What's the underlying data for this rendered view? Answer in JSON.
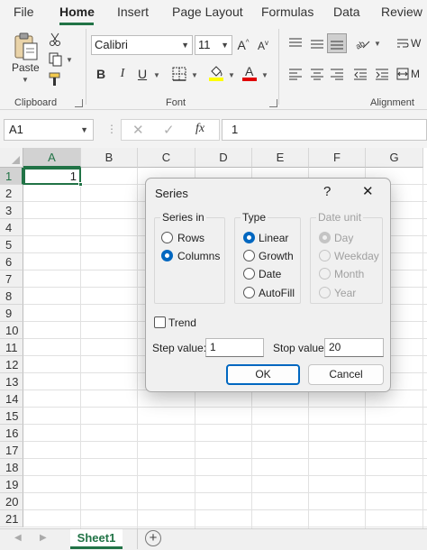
{
  "menu": {
    "tabs": [
      {
        "label": "File"
      },
      {
        "label": "Home"
      },
      {
        "label": "Insert"
      },
      {
        "label": "Page Layout"
      },
      {
        "label": "Formulas"
      },
      {
        "label": "Data"
      },
      {
        "label": "Review"
      }
    ],
    "active_tab": "Home",
    "accent_color": "#217346"
  },
  "ribbon": {
    "clipboard": {
      "paste_label": "Paste",
      "group_label": "Clipboard"
    },
    "font": {
      "font_name": "Calibri",
      "font_size": "11",
      "group_label": "Font",
      "bold": "B",
      "italic": "I",
      "underline": "U"
    },
    "alignment": {
      "group_label": "Alignment",
      "wrap_partial": "W",
      "merge_partial": "M"
    }
  },
  "formula_bar": {
    "name_box": "A1",
    "fx_label": "fx",
    "value": "1"
  },
  "grid": {
    "columns": [
      "A",
      "B",
      "C",
      "D",
      "E",
      "F",
      "G"
    ],
    "rows": [
      "1",
      "2",
      "3",
      "4",
      "5",
      "6",
      "7",
      "8",
      "9",
      "10",
      "11",
      "12",
      "13",
      "14",
      "15",
      "16",
      "17",
      "18",
      "19",
      "20",
      "21"
    ],
    "selected_cell": "A1",
    "cells": {
      "A1": "1"
    }
  },
  "sheet_tabs": {
    "active": "Sheet1",
    "add_symbol": "+"
  },
  "dialog": {
    "title": "Series",
    "help_symbol": "?",
    "close_symbol": "✕",
    "series_in": {
      "label": "Series in",
      "options": [
        "Rows",
        "Columns"
      ],
      "selected": "Columns"
    },
    "type": {
      "label": "Type",
      "options": [
        "Linear",
        "Growth",
        "Date",
        "AutoFill"
      ],
      "selected": "Linear"
    },
    "date_unit": {
      "label": "Date unit",
      "options": [
        "Day",
        "Weekday",
        "Month",
        "Year"
      ],
      "selected": "Day",
      "disabled": true
    },
    "trend": {
      "label": "Trend",
      "checked": false
    },
    "step_value": {
      "label": "Step value:",
      "value": "1"
    },
    "stop_value": {
      "label": "Stop value:",
      "value": "20"
    },
    "ok_label": "OK",
    "cancel_label": "Cancel",
    "focus_color": "#0067c0"
  }
}
